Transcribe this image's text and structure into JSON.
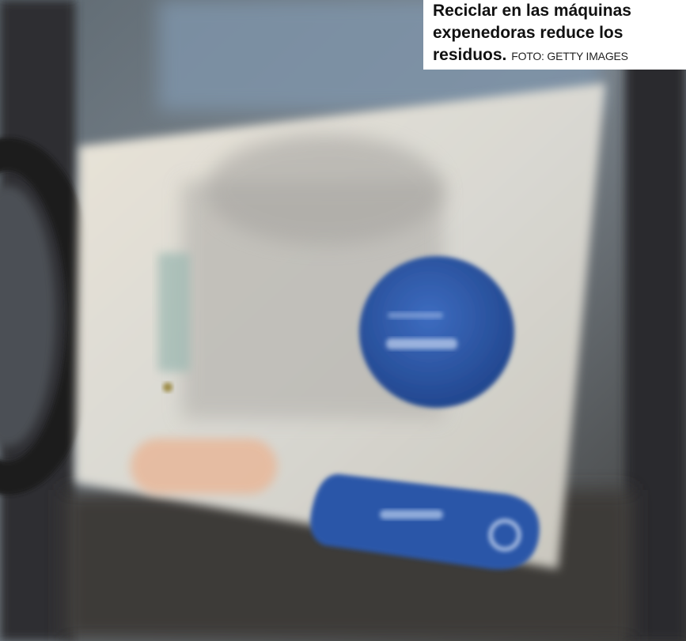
{
  "caption": {
    "text": "Reciclar en las máquinas expenedoras reduce los residuos.",
    "credit": "FOTO: GETTY IMAGES"
  },
  "screen": {
    "accent": "#2f5fb0"
  }
}
